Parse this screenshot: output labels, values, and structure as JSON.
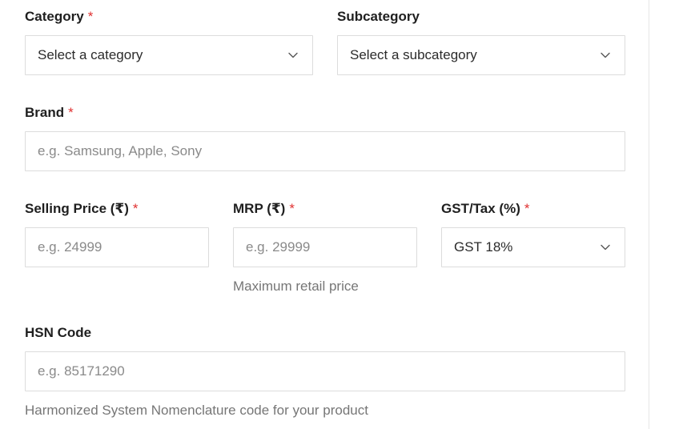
{
  "category": {
    "label": "Category",
    "required_mark": "*",
    "selected": "Select a category",
    "icon": "chevron-down-icon"
  },
  "subcategory": {
    "label": "Subcategory",
    "selected": "Select a subcategory",
    "icon": "chevron-down-icon"
  },
  "brand": {
    "label": "Brand",
    "required_mark": "*",
    "placeholder": "e.g. Samsung, Apple, Sony"
  },
  "selling_price": {
    "label": "Selling Price (₹)",
    "required_mark": "*",
    "placeholder": "e.g. 24999"
  },
  "mrp": {
    "label": "MRP (₹)",
    "required_mark": "*",
    "placeholder": "e.g. 29999",
    "help": "Maximum retail price"
  },
  "gst": {
    "label": "GST/Tax (%)",
    "required_mark": "*",
    "selected": "GST 18%",
    "icon": "chevron-down-icon"
  },
  "hsn": {
    "label": "HSN Code",
    "placeholder": "e.g. 85171290",
    "help": "Harmonized System Nomenclature code for your product"
  },
  "colors": {
    "required": "#e03131",
    "border": "#dcdcdc",
    "help_text": "#767676"
  }
}
